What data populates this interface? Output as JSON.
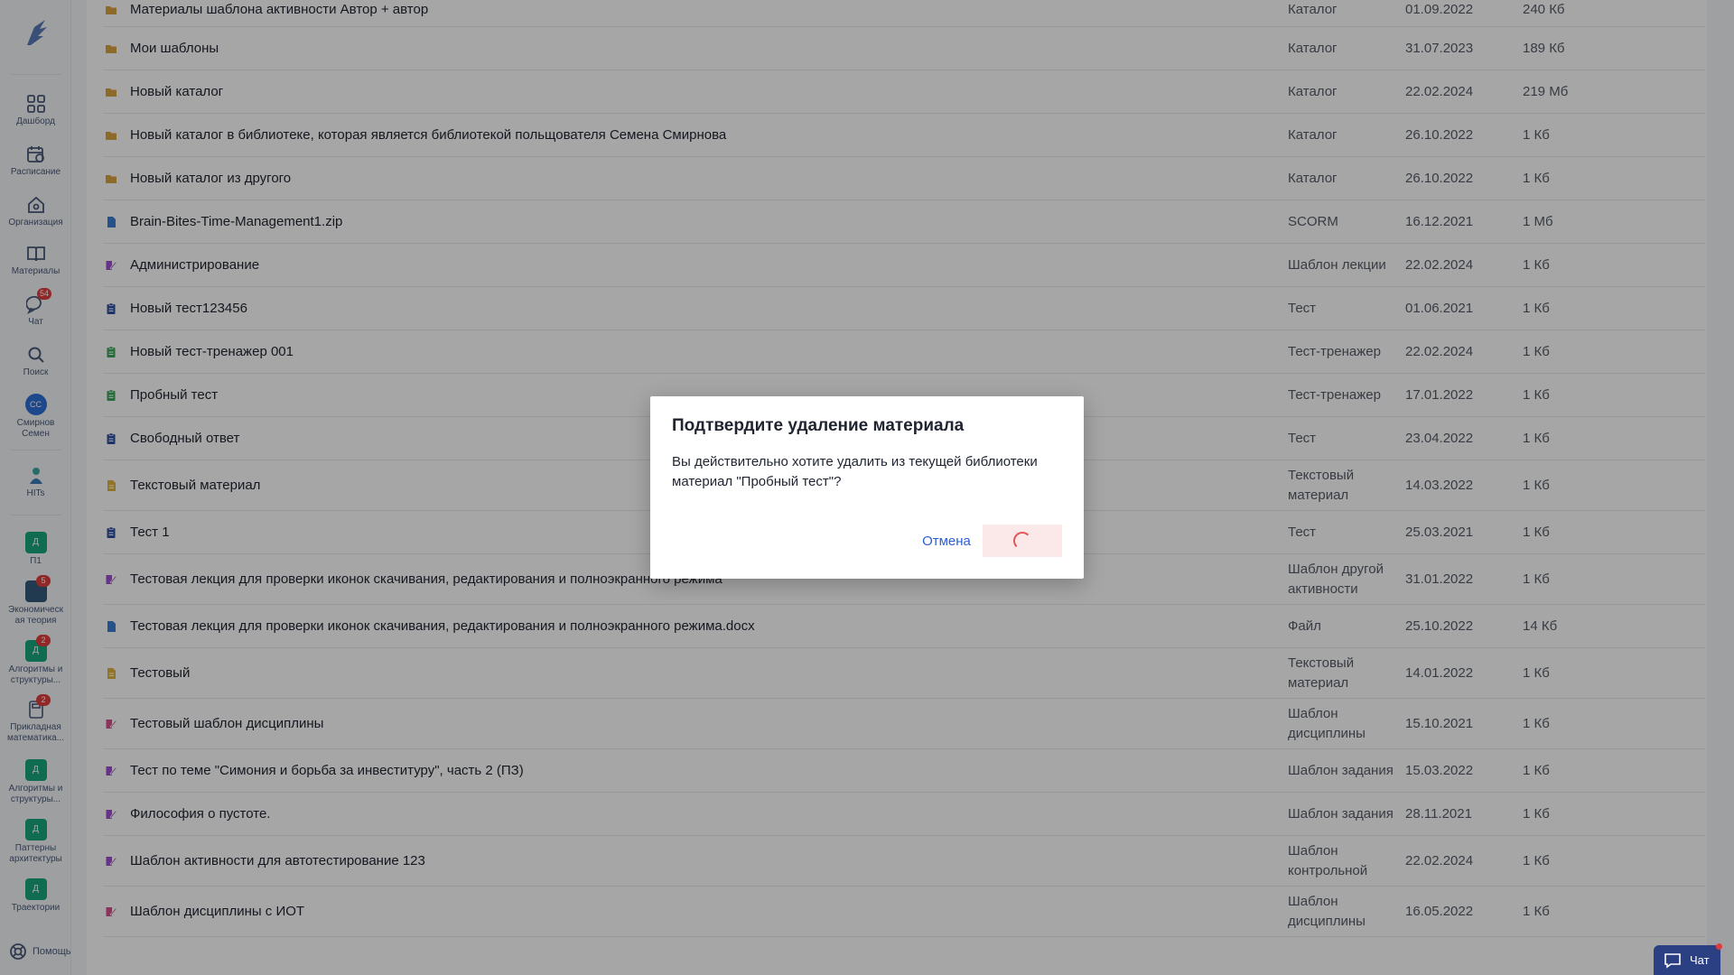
{
  "sidebar": {
    "nav": [
      {
        "label": "Дашборд",
        "icon": "dashboard-icon"
      },
      {
        "label": "Расписание",
        "icon": "schedule-icon"
      },
      {
        "label": "Организация",
        "icon": "organization-icon"
      },
      {
        "label": "Материалы",
        "icon": "materials-icon"
      },
      {
        "label": "Чат",
        "icon": "chat-icon",
        "badge": "54"
      },
      {
        "label": "Поиск",
        "icon": "search-icon"
      }
    ],
    "user": {
      "initials": "СС",
      "name_line1": "Смирнов",
      "name_line2": "Семен"
    },
    "hits": {
      "label": "HITs"
    },
    "courses": [
      {
        "avatar": "Д",
        "line1": "П1",
        "line2": ""
      },
      {
        "avatar": "",
        "line1": "Экономическ",
        "line2": "ая теория",
        "badge": "5"
      },
      {
        "avatar": "Д",
        "line1": "Алгоритмы и",
        "line2": "структуры...",
        "badge": "2"
      },
      {
        "avatar": "",
        "line1": "Прикладная",
        "line2": "математика...",
        "badge": "2"
      },
      {
        "avatar": "Д",
        "line1": "Алгоритмы и",
        "line2": "структуры..."
      },
      {
        "avatar": "Д",
        "line1": "Паттерны",
        "line2": "архитектуры"
      },
      {
        "avatar": "Д",
        "line1": "Траектории",
        "line2": ""
      }
    ],
    "help_label": "Помощь"
  },
  "colors": {
    "folder": "#d9a441",
    "file_blue": "#3b7fd6",
    "template_purple": "#9b4fd0",
    "test_navy": "#2f4f9e",
    "trainer_green": "#3ea55a",
    "text_yellow": "#e0b340",
    "discipline_pink": "#d94f8c"
  },
  "rows": [
    {
      "name": "Материалы шаблона активности Автор + автор",
      "type": "Каталог",
      "date": "01.09.2022",
      "size": "240 Кб",
      "icon": "folder-icon"
    },
    {
      "name": "Мои шаблоны",
      "type": "Каталог",
      "date": "31.07.2023",
      "size": "189 Кб",
      "icon": "folder-icon"
    },
    {
      "name": "Новый каталог",
      "type": "Каталог",
      "date": "22.02.2024",
      "size": "219 Мб",
      "icon": "folder-icon"
    },
    {
      "name": "Новый каталог в библиотеке, которая является библиотекой польщователя Семена Смирнова",
      "type": "Каталог",
      "date": "26.10.2022",
      "size": "1 Кб",
      "icon": "folder-icon"
    },
    {
      "name": "Новый каталог из другого",
      "type": "Каталог",
      "date": "26.10.2022",
      "size": "1 Кб",
      "icon": "folder-icon"
    },
    {
      "name": "Brain-Bites-Time-Management1.zip",
      "type": "SCORM",
      "date": "16.12.2021",
      "size": "1 Мб",
      "icon": "file-icon"
    },
    {
      "name": "Администрирование",
      "type": "Шаблон лекции",
      "date": "22.02.2024",
      "size": "1 Кб",
      "icon": "template-icon"
    },
    {
      "name": "Новый тест123456",
      "type": "Тест",
      "date": "01.06.2021",
      "size": "1 Кб",
      "icon": "test-icon"
    },
    {
      "name": "Новый тест-тренажер 001",
      "type": "Тест-тренажер",
      "date": "22.02.2024",
      "size": "1 Кб",
      "icon": "trainer-icon"
    },
    {
      "name": "Пробный тест",
      "type": "Тест-тренажер",
      "date": "17.01.2022",
      "size": "1 Кб",
      "icon": "trainer-icon"
    },
    {
      "name": "Свободный ответ",
      "type": "Тест",
      "date": "23.04.2022",
      "size": "1 Кб",
      "icon": "test-icon"
    },
    {
      "name": "Текстовый материал",
      "type": "Текстовый материал",
      "date": "14.03.2022",
      "size": "1 Кб",
      "icon": "text-doc-icon"
    },
    {
      "name": "Тест 1",
      "type": "Тест",
      "date": "25.03.2021",
      "size": "1 Кб",
      "icon": "test-icon"
    },
    {
      "name": "Тестовая лекция для проверки иконок скачивания, редактирования и полноэкранного режима",
      "type": "Шаблон другой активности",
      "date": "31.01.2022",
      "size": "1 Кб",
      "icon": "template-icon"
    },
    {
      "name": "Тестовая лекция для проверки иконок скачивания, редактирования и полноэкранного режима.docx",
      "type": "Файл",
      "date": "25.10.2022",
      "size": "14 Кб",
      "icon": "file-icon"
    },
    {
      "name": "Тестовый",
      "type": "Текстовый материал",
      "date": "14.01.2022",
      "size": "1 Кб",
      "icon": "text-doc-icon"
    },
    {
      "name": "Тестовый шаблон дисциплины",
      "type": "Шаблон дисциплины",
      "date": "15.10.2021",
      "size": "1 Кб",
      "icon": "discipline-icon"
    },
    {
      "name": "Тест по теме \"Симония и борьба за инвеституру\", часть 2 (ПЗ)",
      "type": "Шаблон задания",
      "date": "15.03.2022",
      "size": "1 Кб",
      "icon": "template-icon"
    },
    {
      "name": "Философия о пустоте.",
      "type": "Шаблон задания",
      "date": "28.11.2021",
      "size": "1 Кб",
      "icon": "template-icon"
    },
    {
      "name": "Шаблон активности для автотестирование 123",
      "type": "Шаблон контрольной",
      "date": "22.02.2024",
      "size": "1 Кб",
      "icon": "template-icon"
    },
    {
      "name": "Шаблон дисциплины с ИОТ",
      "type": "Шаблон дисциплины",
      "date": "16.05.2022",
      "size": "1 Кб",
      "icon": "discipline-icon"
    }
  ],
  "modal": {
    "title": "Подтвердите удаление материала",
    "message": "Вы действительно хотите удалить из текущей библиотеки материал \"Пробный тест\"?",
    "cancel_label": "Отмена"
  },
  "chat_button": {
    "label": "Чат"
  }
}
